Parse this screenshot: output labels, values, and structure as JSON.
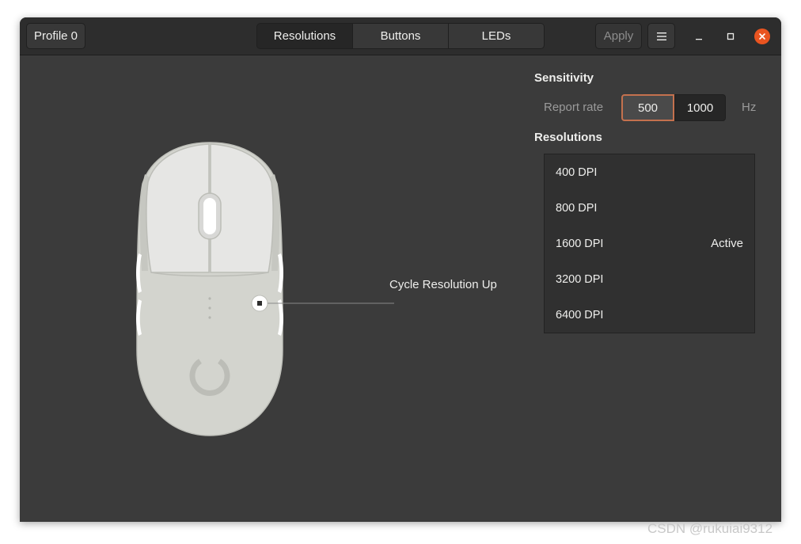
{
  "headerbar": {
    "profile_label": "Profile 0",
    "tabs": [
      {
        "label": "Resolutions",
        "active": true
      },
      {
        "label": "Buttons",
        "active": false
      },
      {
        "label": "LEDs",
        "active": false
      }
    ],
    "apply_label": "Apply",
    "menu_icon": "hamburger-icon",
    "window_controls": [
      "minimize-icon",
      "maximize-icon",
      "close-icon"
    ]
  },
  "sensitivity": {
    "title": "Sensitivity",
    "report_rate_label": "Report rate",
    "rates": [
      {
        "value": "500",
        "selected": true
      },
      {
        "value": "1000",
        "selected": false
      }
    ],
    "unit": "Hz"
  },
  "resolutions": {
    "title": "Resolutions",
    "items": [
      {
        "label": "400 DPI",
        "status": ""
      },
      {
        "label": "800 DPI",
        "status": ""
      },
      {
        "label": "1600 DPI",
        "status": "Active"
      },
      {
        "label": "3200 DPI",
        "status": ""
      },
      {
        "label": "6400 DPI",
        "status": ""
      }
    ]
  },
  "mouse": {
    "callout_label": "Cycle Resolution Up"
  },
  "watermark": "CSDN @rukuiai9312",
  "colors": {
    "accent_selected_border": "#c4714e",
    "close_button": "#e95420",
    "window_bg": "#3b3b3b",
    "headerbar_bg": "#2d2d2d"
  }
}
